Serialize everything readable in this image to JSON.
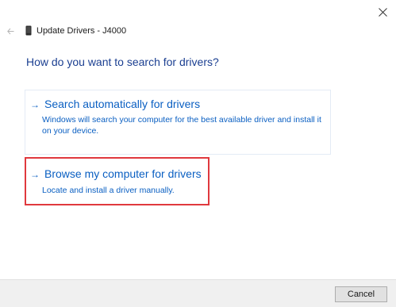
{
  "window": {
    "title": "Update Drivers - J4000",
    "heading": "How do you want to search for drivers?"
  },
  "icons": {
    "close": "close-icon",
    "back": "back-arrow-icon",
    "device": "device-icon",
    "option_arrow": "right-arrow-icon"
  },
  "options": [
    {
      "arrow": "→",
      "title": "Search automatically for drivers",
      "description": "Windows will search your computer for the best available driver and install it on your device."
    },
    {
      "arrow": "→",
      "title": "Browse my computer for drivers",
      "description": "Locate and install a driver manually.",
      "highlighted": true
    }
  ],
  "footer": {
    "cancel_label": "Cancel"
  },
  "colors": {
    "heading": "#1b3f91",
    "link": "#0a5fc2",
    "highlight_border": "#e0393e",
    "footer_bg": "#f0f0f0"
  }
}
